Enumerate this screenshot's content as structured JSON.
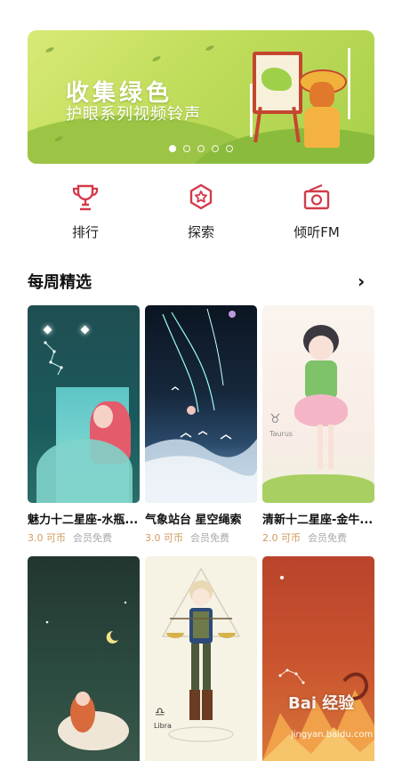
{
  "banner": {
    "title": "收集绿色",
    "subtitle": "护眼系列视频铃声",
    "indicator": {
      "count": 5,
      "active_index": 0
    }
  },
  "nav": [
    {
      "label": "排行",
      "icon": "trophy-icon"
    },
    {
      "label": "探索",
      "icon": "explore-star-icon"
    },
    {
      "label": "倾听FM",
      "icon": "radio-icon"
    }
  ],
  "section": {
    "title": "每周精选",
    "more_icon": "chevron-right-icon"
  },
  "cards": [
    {
      "title": "魅力十二星座-水瓶...",
      "price": "3.0 可币",
      "member": "会员免费"
    },
    {
      "title": "气象站台 星空绳索",
      "price": "3.0 可币",
      "member": "会员免费"
    },
    {
      "title": "清新十二星座-金牛...",
      "price": "2.0 可币",
      "member": "会员免费"
    }
  ],
  "art_text": {
    "taurus": "Taurus",
    "libra": "Libra"
  },
  "watermark": {
    "brand": "Bai 经验",
    "url": "jingyan.baidu.com"
  },
  "colors": {
    "accent": "#d33a4a",
    "price": "#d19a60",
    "member": "#a9a9a9"
  }
}
